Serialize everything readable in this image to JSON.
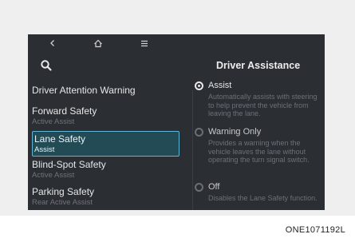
{
  "icons": {
    "back": "back-chevron-icon",
    "home": "home-icon",
    "menu": "menu-icon",
    "search": "search-icon"
  },
  "sidebar": {
    "items": [
      {
        "label": "Driver Attention Warning",
        "sub": ""
      },
      {
        "label": "Forward Safety",
        "sub": "Active Assist"
      },
      {
        "label": "Lane Safety",
        "sub": "Assist"
      },
      {
        "label": "Blind-Spot Safety",
        "sub": "Active Assist"
      },
      {
        "label": "Parking Safety",
        "sub": "Rear Active Assist"
      }
    ],
    "selected_index": 2
  },
  "detail": {
    "title": "Driver Assistance",
    "options": [
      {
        "label": "Assist",
        "description": "Automatically assists with steering to help prevent the vehicle from leaving the lane.",
        "checked": true
      },
      {
        "label": "Warning Only",
        "description": "Provides a warning when the vehicle leaves the lane without operating the turn signal switch.",
        "checked": false
      },
      {
        "label": "Off",
        "description": "Disables the Lane Safety function.",
        "checked": false
      }
    ]
  },
  "caption": "ONE1071192L",
  "colors": {
    "screen_bg": "#2b2e33",
    "selection_fill": "#234b55",
    "selection_border": "#5fb4d4",
    "muted_text": "#6f747b"
  }
}
